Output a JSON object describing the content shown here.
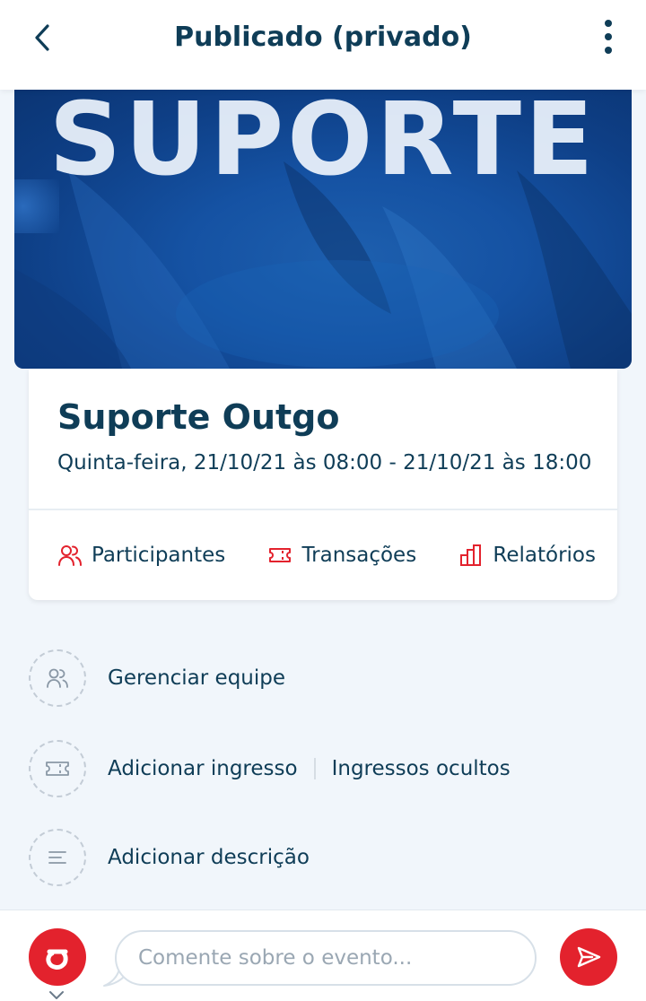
{
  "header": {
    "title": "Publicado (privado)",
    "back_icon": "chevron-left-icon",
    "menu_icon": "more-vertical-icon"
  },
  "banner": {
    "text": "SUPORTE"
  },
  "event": {
    "name": "Suporte Outgo",
    "datetime": "Quinta-feira, 21/10/21 às 08:00 - 21/10/21 às 18:00"
  },
  "card_actions": [
    {
      "label": "Participantes",
      "icon": "users-icon"
    },
    {
      "label": "Transações",
      "icon": "ticket-icon"
    },
    {
      "label": "Relatórios",
      "icon": "bar-chart-icon"
    }
  ],
  "menu": {
    "manage_team": "Gerenciar equipe",
    "add_ticket": "Adicionar ingresso",
    "hidden_tickets": "Ingressos ocultos",
    "add_description": "Adicionar descrição"
  },
  "comment": {
    "placeholder": "Comente sobre o evento..."
  },
  "colors": {
    "primary_text": "#0f3d57",
    "accent_red": "#e3222d",
    "background": "#f1f6fb"
  }
}
